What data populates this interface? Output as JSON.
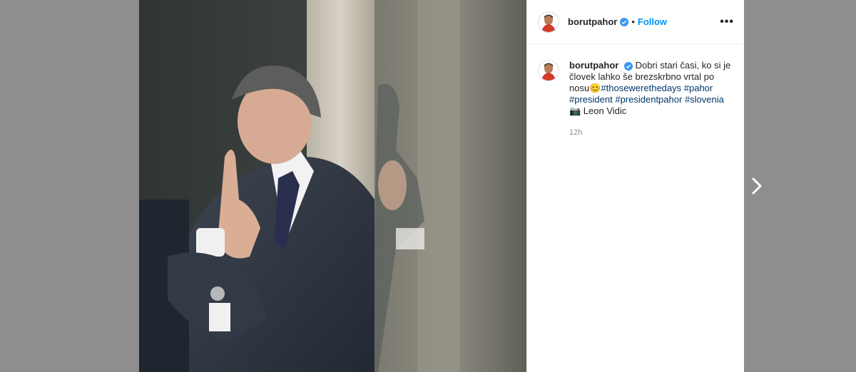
{
  "post": {
    "username": "borutpahor",
    "follow_label": "Follow",
    "more_label": "•••",
    "caption_intro": "Dobri stari časi, ko si je človek lahko še brezskrbno vrtal po nosu😊",
    "hashtags": [
      "#thosewerethedays",
      "#pahor",
      "#president",
      "#presidentpahor",
      "#slovenia"
    ],
    "photo_credit": "📷 Leon Vidic",
    "timestamp": "12h"
  },
  "colors": {
    "follow": "#0095f6",
    "hashtag": "#00376b",
    "verified": "#3897f0",
    "backdrop": "#8e8e8e"
  },
  "icons": {
    "verified": "verified-badge-icon",
    "next": "chevron-right-icon",
    "more": "more-options-icon"
  }
}
